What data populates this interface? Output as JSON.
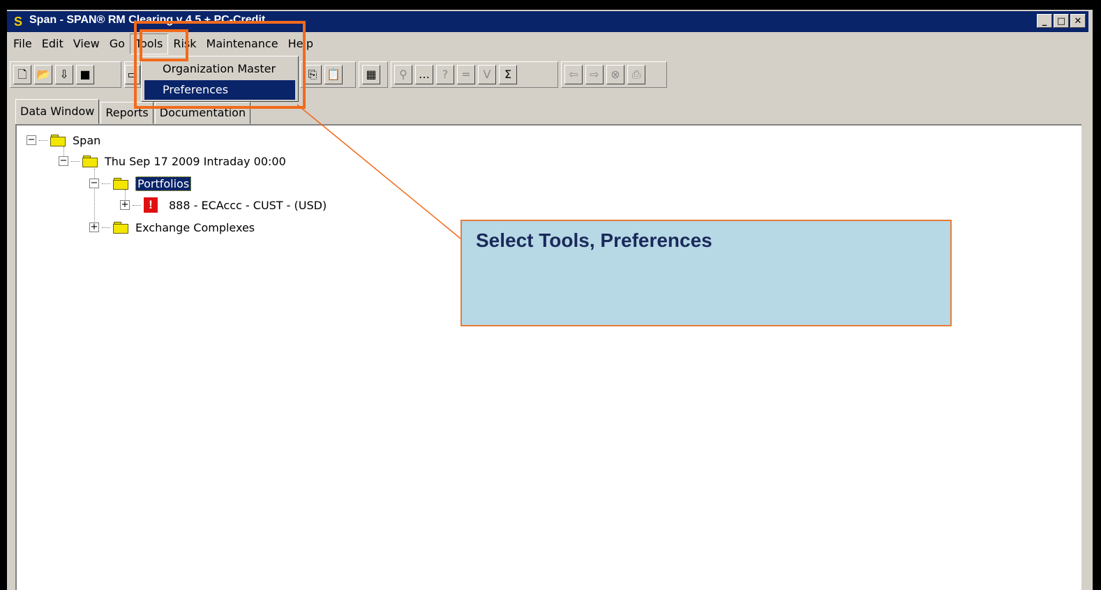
{
  "window": {
    "title": "Span - SPAN® RM Clearing v 4.5 + PC-Credit",
    "icon_letter": "S",
    "caption_buttons": [
      "minimize-icon",
      "maximize-icon",
      "close-icon"
    ]
  },
  "menubar": {
    "items": [
      "File",
      "Edit",
      "View",
      "Go",
      "Tools",
      "Risk",
      "Maintenance",
      "Help"
    ],
    "open_menu": "Tools"
  },
  "tools_menu": {
    "items": [
      "Organization Master",
      "Preferences"
    ],
    "highlighted": "Preferences"
  },
  "toolbar": {
    "icons": [
      "new-document-icon",
      "open-folder-icon",
      "download-icon",
      "save-icon",
      "folder-icon",
      "copy-icon",
      "paste-icon",
      "calculator-icon",
      "search-icon",
      "ellipsis-icon",
      "help-icon",
      "equals-icon",
      "v-icon",
      "sigma-icon",
      "back-arrow-icon",
      "forward-arrow-icon",
      "stop-icon",
      "print-icon"
    ]
  },
  "tabs": [
    "Data Window",
    "Reports",
    "Documentation"
  ],
  "active_tab": "Data Window",
  "tree": {
    "root": "Span",
    "date_node": "Thu Sep 17 2009 Intraday 00:00",
    "portfolios": "Portfolios",
    "portfolio_item": "888 - ECAccc - CUST - (USD)",
    "exchange_complexes": "Exchange Complexes"
  },
  "callout": {
    "text": "Select Tools, Preferences"
  },
  "colors": {
    "highlight_orange": "#f26a1b",
    "callout_bg": "#b7d8e5",
    "title_bar": "#0a246a",
    "selection": "#0a246a"
  }
}
